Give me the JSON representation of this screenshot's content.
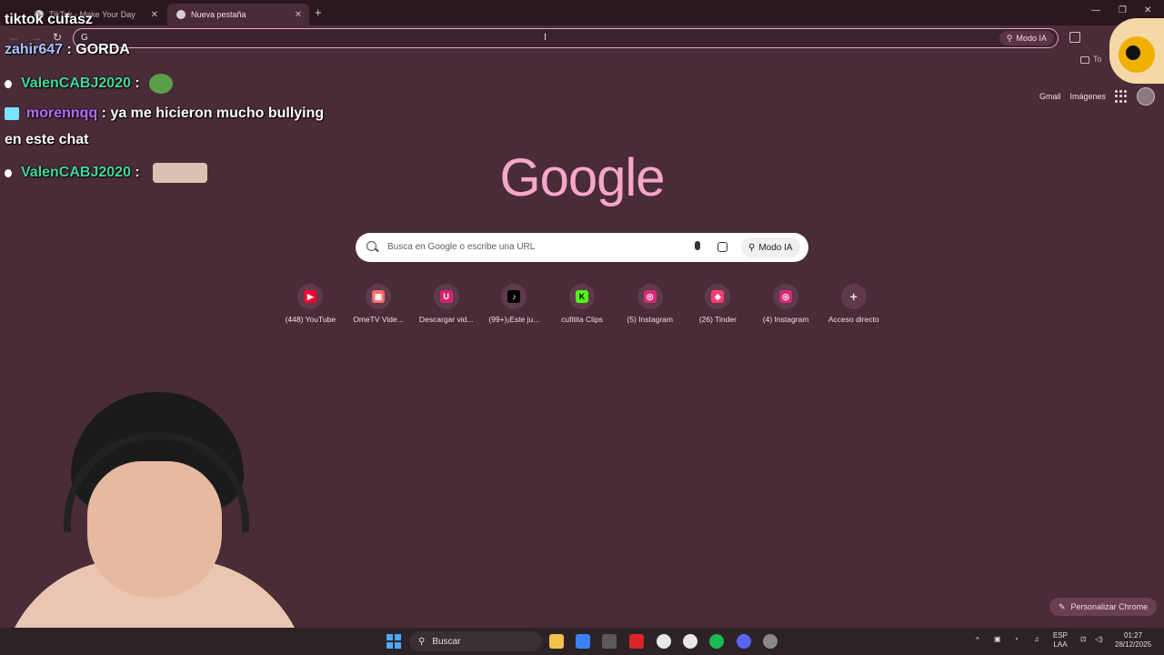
{
  "tabs": [
    {
      "title": "TikTok - Make Your Day"
    },
    {
      "title": "Nueva pestaña"
    }
  ],
  "omnibox": {
    "value": "G",
    "modo_ia": "Modo IA"
  },
  "bookmarks_bar": {
    "label": "To"
  },
  "google": {
    "logo_text": "Google",
    "links": {
      "gmail": "Gmail",
      "images": "Imágenes"
    },
    "search": {
      "placeholder": "Busca en Google o escribe una URL",
      "modo_ia": "Modo IA"
    },
    "shortcuts": [
      {
        "label": "(448) YouTube",
        "icon": "youtube-icon",
        "color": "#ff0033",
        "glyph": "▶"
      },
      {
        "label": "OmeTV Vide...",
        "icon": "ometv-icon",
        "color": "#ff6b6b",
        "glyph": "▣"
      },
      {
        "label": "Descargar vid...",
        "icon": "download-icon",
        "color": "#d6246e",
        "glyph": "U"
      },
      {
        "label": "(99+)¡Este ju...",
        "icon": "tiktok-icon",
        "color": "#000000",
        "glyph": "♪"
      },
      {
        "label": "cufitita Clips",
        "icon": "kick-icon",
        "color": "#53fc18",
        "glyph": "K"
      },
      {
        "label": "(5) Instagram",
        "icon": "instagram-icon",
        "color": "#d62976",
        "glyph": "◎"
      },
      {
        "label": "(26) Tinder",
        "icon": "tinder-icon",
        "color": "#fe3c72",
        "glyph": "◆"
      },
      {
        "label": "(4) Instagram",
        "icon": "instagram-icon",
        "color": "#d62976",
        "glyph": "◎"
      },
      {
        "label": "Acceso directo",
        "icon": "plus-icon",
        "color": "#5e3a4b",
        "glyph": "+"
      }
    ],
    "personalize": "Personalizar Chrome"
  },
  "overlay": {
    "title": "tiktok cufasz",
    "chat": [
      {
        "user": "zahir647",
        "sep": " : ",
        "message": "GORDA"
      },
      {
        "user": "ValenCABJ2020",
        "sep": " : ",
        "message": ""
      },
      {
        "user": "morennqq",
        "sep": " : ",
        "message": "ya me hicieron mucho bullying"
      },
      {
        "continuation": "en este chat"
      },
      {
        "user": "ValenCABJ2020",
        "sep": " : ",
        "message": ""
      }
    ]
  },
  "taskbar": {
    "search": "Buscar",
    "lang": "ESP",
    "lang_sub": "LAA",
    "time": "01:27",
    "date": "28/12/2025"
  }
}
